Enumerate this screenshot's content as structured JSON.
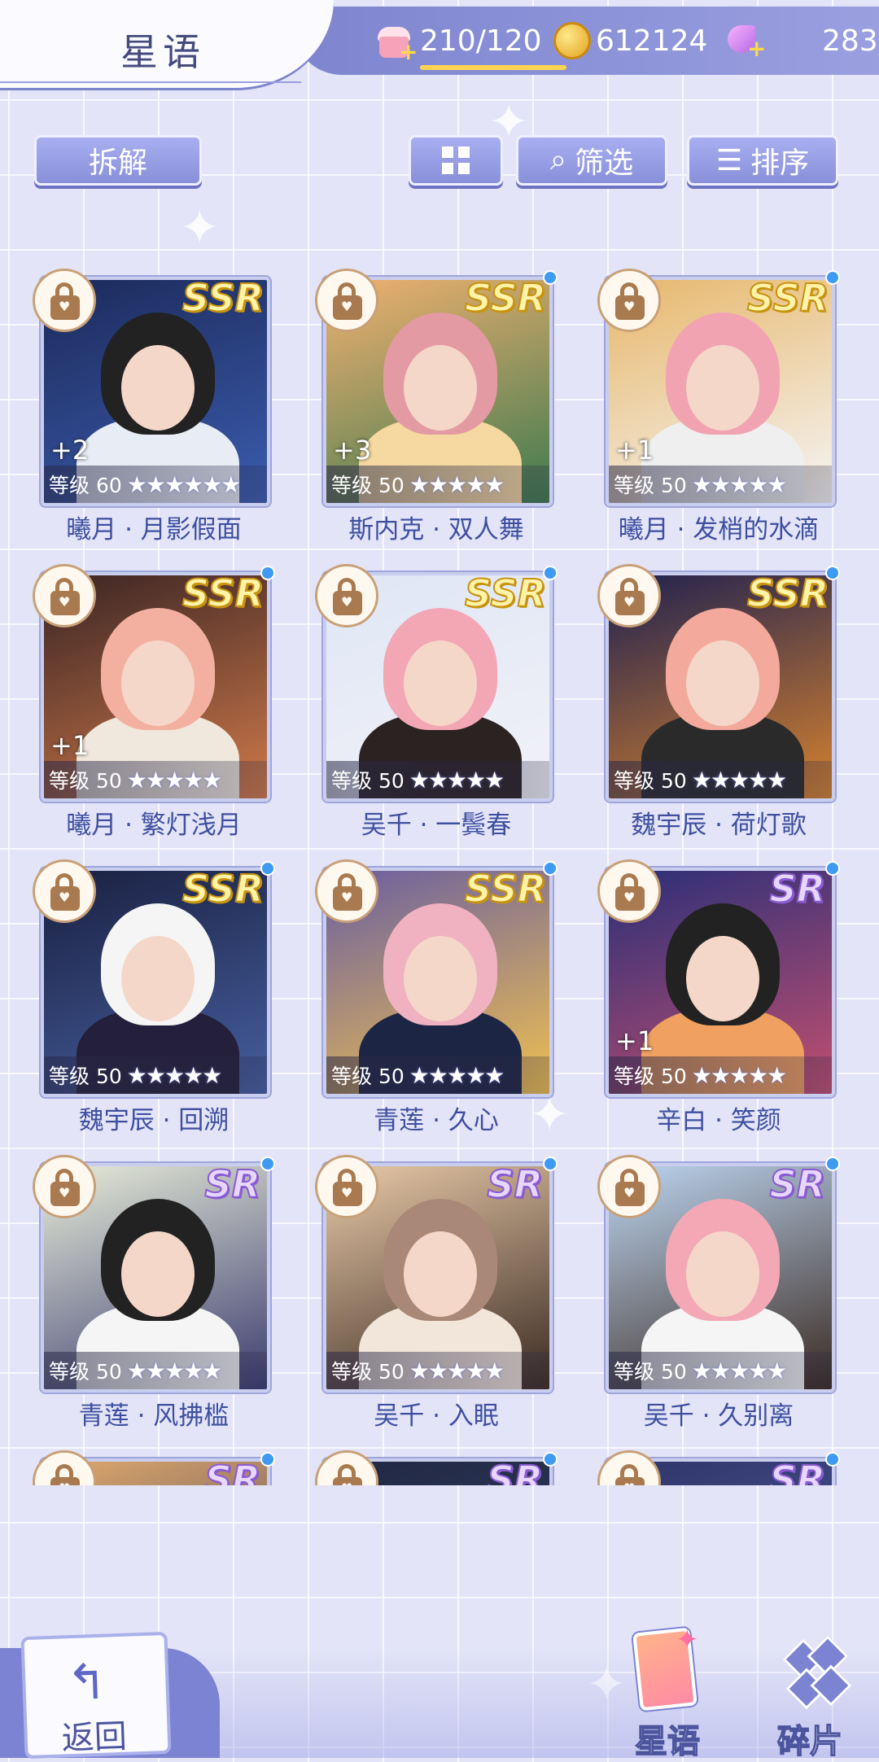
{
  "header": {
    "title": "星语",
    "stamina": "210/120",
    "coins": "612124",
    "gems": "283"
  },
  "toolbar": {
    "dismantle_label": "拆解",
    "filter_label": "筛选",
    "sort_label": "排序"
  },
  "cards": [
    {
      "name": "曦月 · 月影假面",
      "level": "等级 60",
      "rarity": "SSR",
      "stars": "★★★★★★",
      "bonus": "+2",
      "new": false
    },
    {
      "name": "斯内克 · 双人舞",
      "level": "等级 50",
      "rarity": "SSR",
      "stars": "★★★★★",
      "bonus": "+3",
      "new": true
    },
    {
      "name": "曦月 · 发梢的水滴",
      "level": "等级 50",
      "rarity": "SSR",
      "stars": "★★★★★",
      "bonus": "+1",
      "new": true
    },
    {
      "name": "曦月 · 繁灯浅月",
      "level": "等级 50",
      "rarity": "SSR",
      "stars": "★★★★★",
      "bonus": "+1",
      "new": true
    },
    {
      "name": "吴千 · 一鬓春",
      "level": "等级 50",
      "rarity": "SSR",
      "stars": "★★★★★",
      "bonus": "",
      "new": true
    },
    {
      "name": "魏宇辰 · 荷灯歌",
      "level": "等级 50",
      "rarity": "SSR",
      "stars": "★★★★★",
      "bonus": "",
      "new": true
    },
    {
      "name": "魏宇辰 · 回溯",
      "level": "等级 50",
      "rarity": "SSR",
      "stars": "★★★★★",
      "bonus": "",
      "new": true
    },
    {
      "name": "青莲 · 久心",
      "level": "等级 50",
      "rarity": "SSR",
      "stars": "★★★★★",
      "bonus": "",
      "new": true
    },
    {
      "name": "辛白 · 笑颜",
      "level": "等级 50",
      "rarity": "SR",
      "stars": "★★★★★",
      "bonus": "+1",
      "new": true
    },
    {
      "name": "青莲 · 风拂槛",
      "level": "等级 50",
      "rarity": "SR",
      "stars": "★★★★★",
      "bonus": "",
      "new": true
    },
    {
      "name": "吴千 · 入眠",
      "level": "等级 50",
      "rarity": "SR",
      "stars": "★★★★★",
      "bonus": "",
      "new": true
    },
    {
      "name": "吴千 · 久别离",
      "level": "等级 50",
      "rarity": "SR",
      "stars": "★★★★★",
      "bonus": "",
      "new": true
    },
    {
      "name": "",
      "level": "",
      "rarity": "SR",
      "stars": "",
      "bonus": "",
      "new": true
    },
    {
      "name": "",
      "level": "",
      "rarity": "SR",
      "stars": "",
      "bonus": "",
      "new": true
    },
    {
      "name": "",
      "level": "",
      "rarity": "SR",
      "stars": "",
      "bonus": "",
      "new": true
    }
  ],
  "nav": {
    "back_label": "返回",
    "stars_label": "星语",
    "fragments_label": "碎片"
  },
  "colors": {
    "accent": "#7e85cf",
    "text_name": "#3e4fa0",
    "new_dot": "#3f9bf2",
    "ssr_gold": "#c79312",
    "sr_purple": "#8a5bd1"
  }
}
